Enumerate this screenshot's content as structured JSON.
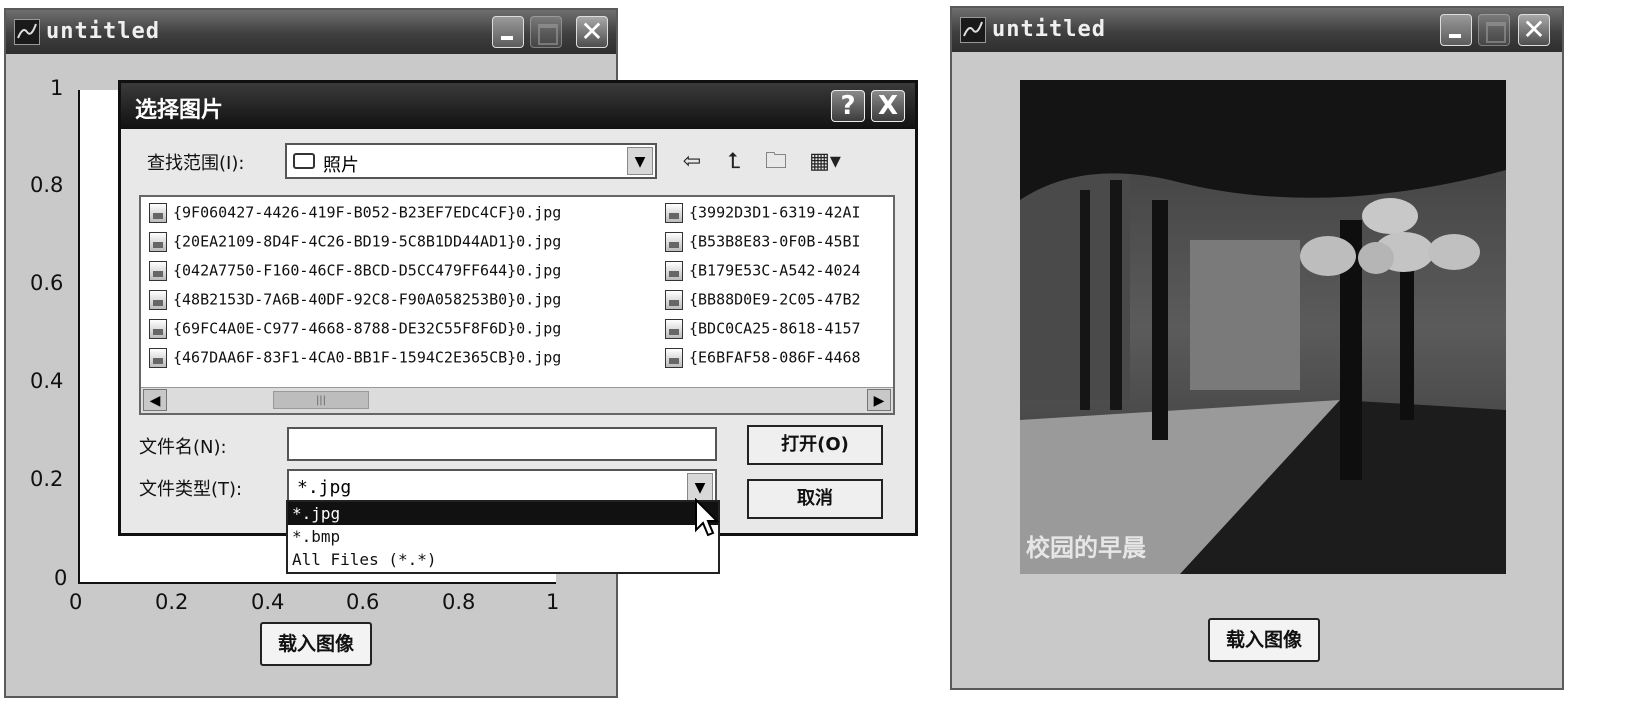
{
  "left_window": {
    "title": "untitled",
    "axes": {
      "y_ticks": [
        "1",
        "0.8",
        "0.6",
        "0.4",
        "0.2",
        "0"
      ],
      "x_ticks": [
        "0",
        "0.2",
        "0.4",
        "0.6",
        "0.8",
        "1"
      ]
    },
    "load_button": "载入图像"
  },
  "dialog": {
    "title": "选择图片",
    "help_button": "?",
    "close_button": "X",
    "lookin_label": "查找范围(I):",
    "lookin_value": "照片",
    "files_col1": [
      "{9F060427-4426-419F-B052-B23EF7EDC4CF}0.jpg",
      "{20EA2109-8D4F-4C26-BD19-5C8B1DD44AD1}0.jpg",
      "{042A7750-F160-46CF-8BCD-D5CC479FF644}0.jpg",
      "{48B2153D-7A6B-40DF-92C8-F90A058253B0}0.jpg",
      "{69FC4A0E-C977-4668-8788-DE32C55F8F6D}0.jpg",
      "{467DAA6F-83F1-4CA0-BB1F-1594C2E365CB}0.jpg"
    ],
    "files_col2": [
      "{3992D3D1-6319-42AI",
      "{B53B8E83-0F0B-45BI",
      "{B179E53C-A542-4024",
      "{BB88D0E9-2C05-47B2",
      "{BDC0CA25-8618-4157",
      "{E6BFAF58-086F-4468"
    ],
    "scroll_thumb": "|||",
    "filename_label": "文件名(N):",
    "filename_value": "",
    "filetype_label": "文件类型(T):",
    "filetype_value": "*.jpg",
    "open_button": "打开(O)",
    "cancel_button": "取消",
    "filetype_options": [
      "*.jpg",
      "*.bmp",
      "All Files (*.*)"
    ]
  },
  "right_window": {
    "title": "untitled",
    "image_caption": "校园的早晨",
    "load_button": "载入图像"
  }
}
